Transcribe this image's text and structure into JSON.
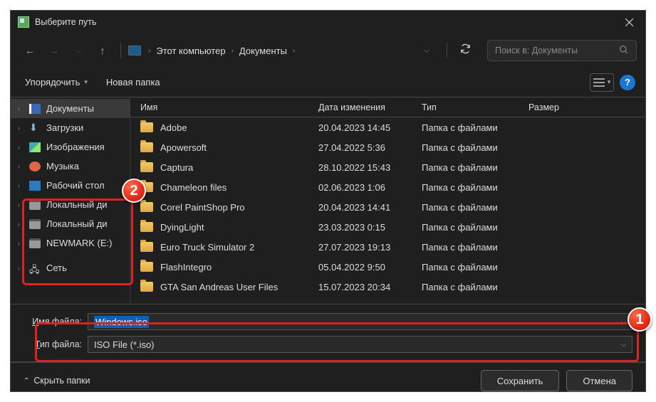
{
  "title": "Выберите путь",
  "breadcrumb": {
    "pc": "Этот компьютер",
    "docs": "Документы"
  },
  "search_placeholder": "Поиск в: Документы",
  "toolbar": {
    "organize": "Упорядочить",
    "newfolder": "Новая папка"
  },
  "columns": {
    "name": "Имя",
    "date": "Дата изменения",
    "type": "Тип",
    "size": "Размер"
  },
  "navitems": [
    {
      "label": "Документы",
      "ico": "doc",
      "sel": true
    },
    {
      "label": "Загрузки",
      "ico": "dl"
    },
    {
      "label": "Изображения",
      "ico": "img"
    },
    {
      "label": "Музыка",
      "ico": "mus"
    },
    {
      "label": "Рабочий стол",
      "ico": "desk"
    },
    {
      "label": "Локальный ди",
      "ico": "drv"
    },
    {
      "label": "Локальный ди",
      "ico": "drv"
    },
    {
      "label": "NEWMARK (E:)",
      "ico": "drv"
    }
  ],
  "net_label": "Сеть",
  "rows": [
    {
      "name": "Adobe",
      "date": "20.04.2023 14:45",
      "type": "Папка с файлами"
    },
    {
      "name": "Apowersoft",
      "date": "27.04.2022 5:36",
      "type": "Папка с файлами"
    },
    {
      "name": "Captura",
      "date": "28.10.2022 15:43",
      "type": "Папка с файлами"
    },
    {
      "name": "Chameleon files",
      "date": "02.06.2023 1:06",
      "type": "Папка с файлами"
    },
    {
      "name": "Corel PaintShop Pro",
      "date": "20.04.2023 14:41",
      "type": "Папка с файлами"
    },
    {
      "name": "DyingLight",
      "date": "23.03.2023 0:15",
      "type": "Папка с файлами"
    },
    {
      "name": "Euro Truck Simulator 2",
      "date": "27.07.2023 19:13",
      "type": "Папка с файлами"
    },
    {
      "name": "FlashIntegro",
      "date": "05.04.2022 9:50",
      "type": "Папка с файлами"
    },
    {
      "name": "GTA San Andreas User Files",
      "date": "15.07.2023 20:34",
      "type": "Папка с файлами"
    }
  ],
  "form": {
    "name_label": "Имя файла:",
    "name_value": "Windows.iso",
    "type_label": "Тип файла:",
    "type_value": "ISO File (*.iso)"
  },
  "footer": {
    "hide": "Скрыть папки",
    "save": "Сохранить",
    "cancel": "Отмена"
  },
  "badge1": "1",
  "badge2": "2"
}
